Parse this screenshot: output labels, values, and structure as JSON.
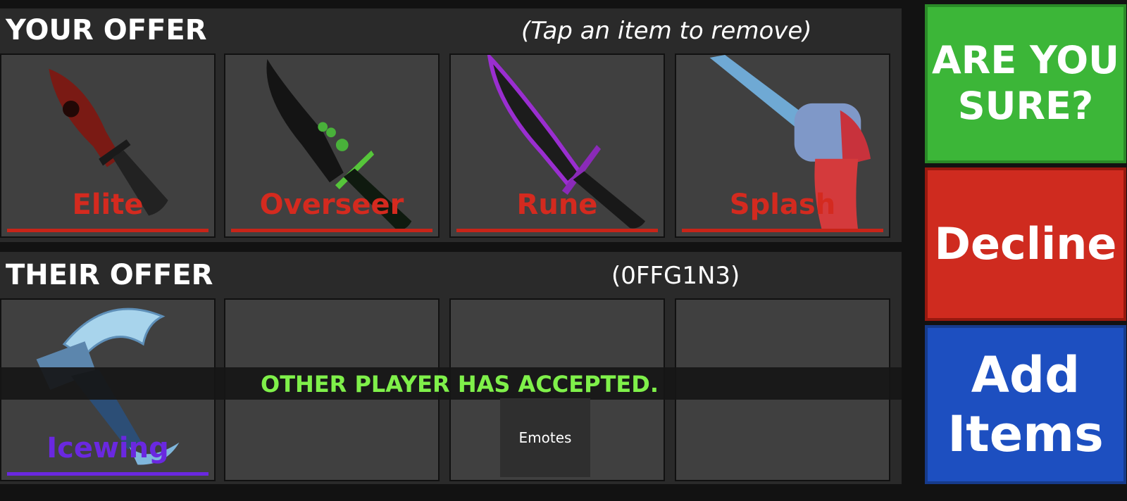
{
  "your_offer": {
    "title": "YOUR OFFER",
    "hint": "(Tap an item to remove)",
    "items": [
      {
        "name": "Elite",
        "icon": "red-knife-icon",
        "rarity_color": "#d42a1f"
      },
      {
        "name": "Overseer",
        "icon": "green-knife-icon",
        "rarity_color": "#d42a1f"
      },
      {
        "name": "Rune",
        "icon": "purple-knife-icon",
        "rarity_color": "#d42a1f"
      },
      {
        "name": "Splash",
        "icon": "revolver-icon",
        "rarity_color": "#d42a1f"
      }
    ]
  },
  "their_offer": {
    "title": "THEIR OFFER",
    "player": "(0FFG1N3)",
    "items": [
      {
        "name": "Icewing",
        "icon": "scythe-icon",
        "rarity_color": "#6a28e0"
      }
    ]
  },
  "banner": "OTHER PLAYER HAS ACCEPTED.",
  "emotes_label": "Emotes",
  "buttons": {
    "confirm": "ARE YOU SURE?",
    "decline": "Decline",
    "add_items": "Add Items"
  },
  "colors": {
    "confirm": "#3cb638",
    "decline": "#cf2b1f",
    "add_items": "#1d4fc0",
    "banner_text": "#7ff04a"
  }
}
